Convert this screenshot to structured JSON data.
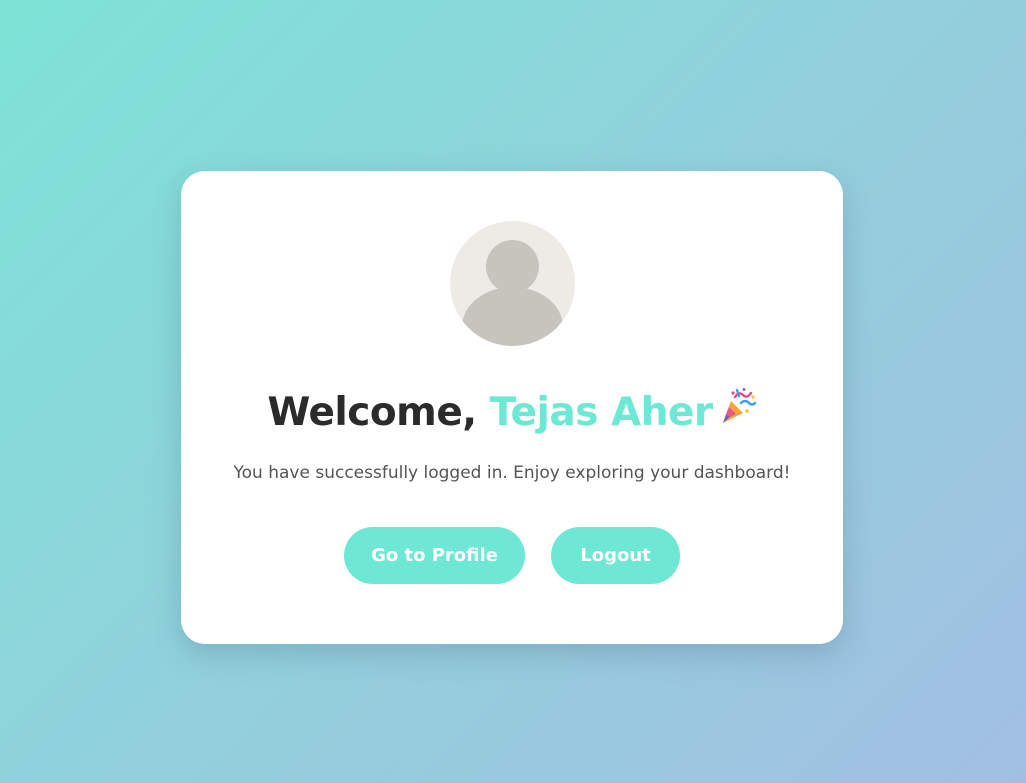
{
  "card": {
    "title_prefix": "Welcome, ",
    "user_name": "Tejas Aher",
    "party_icon": "party-popper-icon",
    "message": "You have successfully logged in. Enjoy exploring your dashboard!"
  },
  "buttons": {
    "profile_label": "Go to Profile",
    "logout_label": "Logout"
  },
  "colors": {
    "accent": "#6ee8d4",
    "title": "#2b2b2b",
    "text": "#555555",
    "avatar_bg": "#eeebe7",
    "avatar_fg": "#c7c4be"
  }
}
